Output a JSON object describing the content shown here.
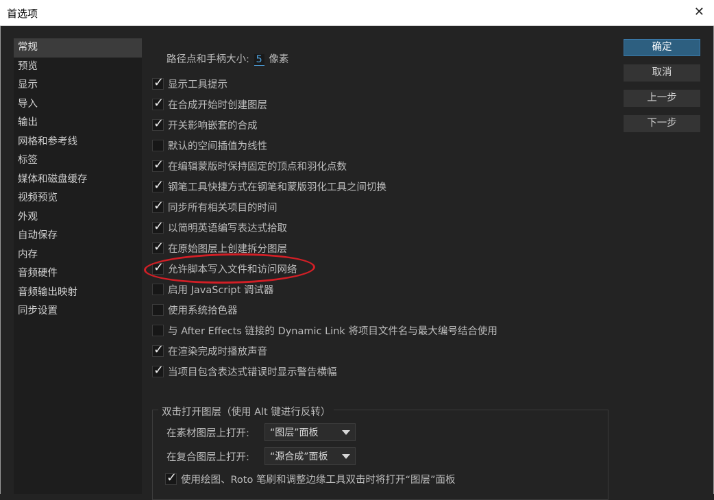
{
  "window": {
    "title": "首选项",
    "close_glyph": "✕"
  },
  "sidebar": {
    "items": [
      {
        "label": "常规",
        "selected": true
      },
      {
        "label": "预览"
      },
      {
        "label": "显示"
      },
      {
        "label": "导入"
      },
      {
        "label": "输出"
      },
      {
        "label": "网格和参考线"
      },
      {
        "label": "标签"
      },
      {
        "label": "媒体和磁盘缓存"
      },
      {
        "label": "视频预览"
      },
      {
        "label": "外观"
      },
      {
        "label": "自动保存"
      },
      {
        "label": "内存"
      },
      {
        "label": "音频硬件"
      },
      {
        "label": "音频输出映射"
      },
      {
        "label": "同步设置"
      }
    ]
  },
  "path_size": {
    "label": "路径点和手柄大小:",
    "value": "5",
    "unit": "像素"
  },
  "options": [
    {
      "label": "显示工具提示",
      "checked": true
    },
    {
      "label": "在合成开始时创建图层",
      "checked": true
    },
    {
      "label": "开关影响嵌套的合成",
      "checked": true
    },
    {
      "label": "默认的空间插值为线性",
      "checked": false
    },
    {
      "label": "在编辑蒙版时保持固定的顶点和羽化点数",
      "checked": true
    },
    {
      "label": "钢笔工具快捷方式在钢笔和蒙版羽化工具之间切换",
      "checked": true
    },
    {
      "label": "同步所有相关项目的时间",
      "checked": true
    },
    {
      "label": "以简明英语编写表达式拾取",
      "checked": true
    },
    {
      "label": "在原始图层上创建拆分图层",
      "checked": true
    },
    {
      "label": "允许脚本写入文件和访问网络",
      "checked": true
    },
    {
      "label": "启用 JavaScript 调试器",
      "checked": false
    },
    {
      "label": "使用系统拾色器",
      "checked": false
    },
    {
      "label": "与 After Effects 链接的 Dynamic Link 将项目文件名与最大编号结合使用",
      "checked": false
    },
    {
      "label": "在渲染完成时播放声音",
      "checked": true
    },
    {
      "label": "当项目包含表达式错误时显示警告横幅",
      "checked": true
    }
  ],
  "double_click_group": {
    "title": "双击打开图层（使用 Alt 键进行反转）",
    "footage_label": "在素材图层上打开:",
    "footage_value": "“图层”面板",
    "comp_label": "在复合图层上打开:",
    "comp_value": "“源合成”面板",
    "paint_option": {
      "label": "使用绘图、Roto 笔刷和调整边缘工具双击时将打开“图层”面板",
      "checked": true
    }
  },
  "buttons": {
    "ok": "确定",
    "cancel": "取消",
    "prev": "上一步",
    "next": "下一步"
  },
  "colors": {
    "annotation": "#d21f26",
    "accent": "#2d5f80",
    "background": "#232323"
  },
  "icons": {
    "checkmark": "checkmark-icon",
    "close": "close-icon",
    "dropdown": "chevron-down-icon"
  }
}
